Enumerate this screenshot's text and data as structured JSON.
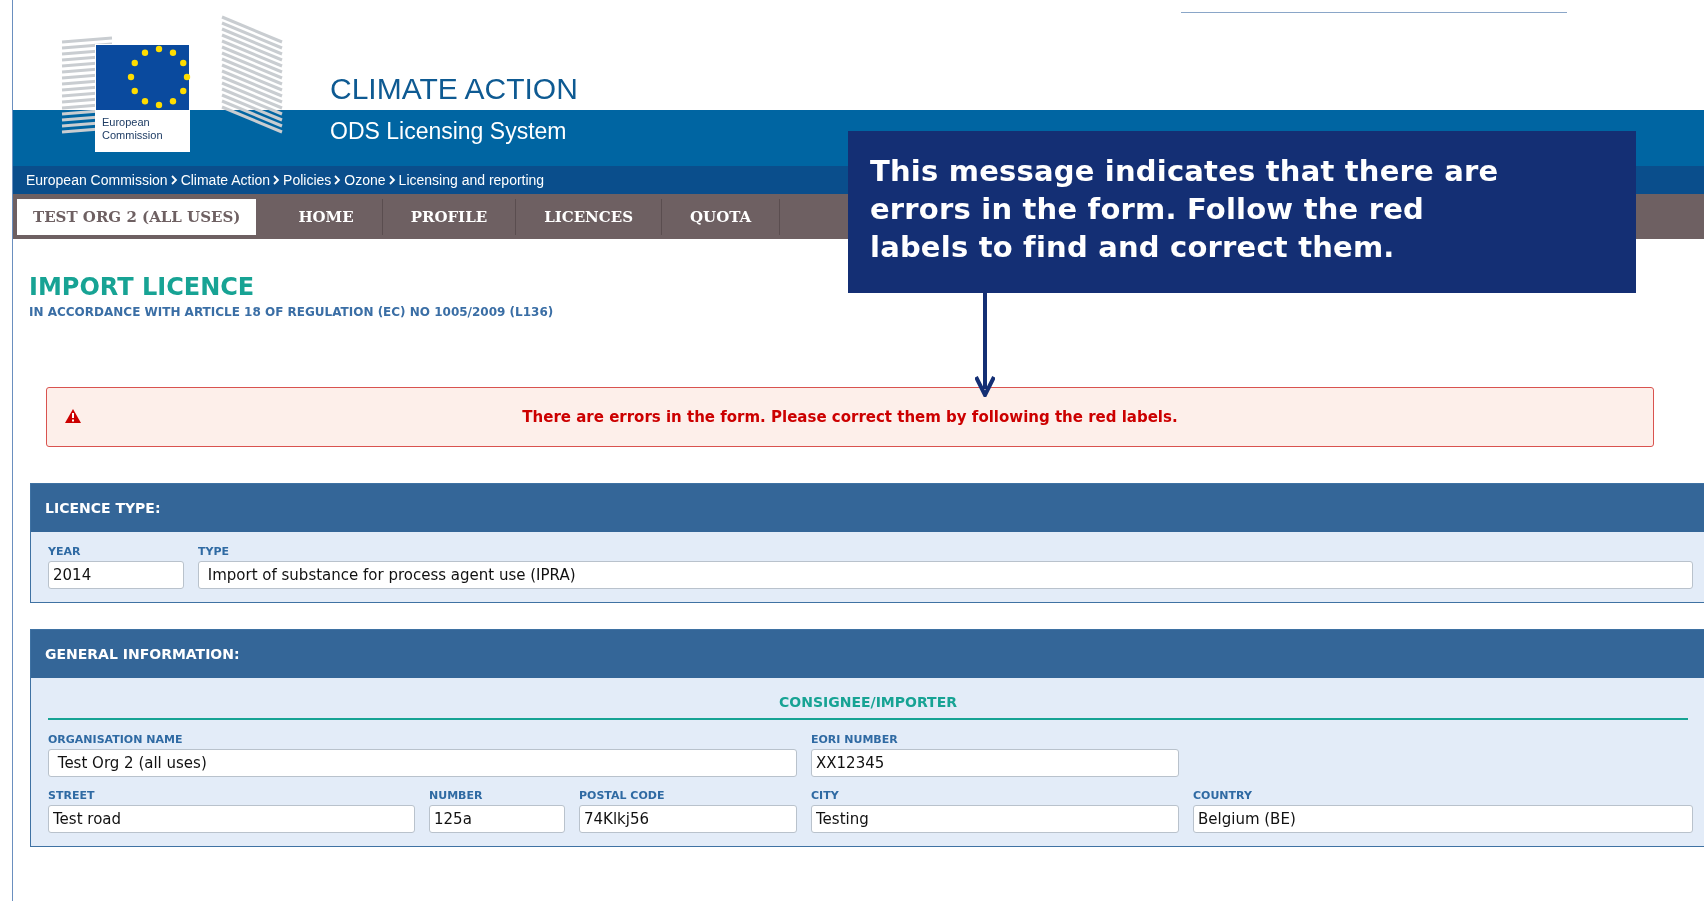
{
  "header": {
    "logo_text": "European Commission",
    "site_title": "CLIMATE ACTION",
    "site_subtitle": "ODS Licensing System"
  },
  "breadcrumb": [
    "European Commission",
    "Climate Action",
    "Policies",
    "Ozone",
    "Licensing and reporting"
  ],
  "nav_tabs": [
    {
      "label": "TEST ORG 2 (ALL USES)",
      "selected": true
    },
    {
      "label": "HOME",
      "selected": false
    },
    {
      "label": "PROFILE",
      "selected": false
    },
    {
      "label": "LICENCES",
      "selected": false
    },
    {
      "label": "QUOTA",
      "selected": false
    }
  ],
  "page": {
    "title": "IMPORT LICENCE",
    "subtitle": "IN ACCORDANCE WITH ARTICLE 18 OF REGULATION (EC) NO 1005/2009 (L136)"
  },
  "error_message": "There are errors in the form. Please correct them by following the red labels.",
  "callout": "This message indicates that there are errors in the form. Follow the red labels to find and correct them.",
  "sections": [
    {
      "title": "LICENCE TYPE:",
      "field_groups": [
        {
          "fields": [
            {
              "label": "YEAR",
              "value": "2014"
            },
            {
              "label": "TYPE",
              "value": " Import of substance for process agent use (IPRA)"
            }
          ]
        }
      ]
    },
    {
      "title": "GENERAL INFORMATION:",
      "subheading": "CONSIGNEE/IMPORTER",
      "field_groups": [
        {
          "fields": [
            {
              "label": "ORGANISATION NAME",
              "value": " Test Org 2 (all uses)"
            },
            {
              "label": "EORI NUMBER",
              "value": "XX12345"
            }
          ]
        },
        {
          "fields": [
            {
              "label": "STREET",
              "value": "Test road"
            },
            {
              "label": "NUMBER",
              "value": "125a"
            },
            {
              "label": "POSTAL CODE",
              "value": "74Klkj56"
            },
            {
              "label": "CITY",
              "value": "Testing"
            },
            {
              "label": "COUNTRY",
              "value": "Belgium (BE)"
            }
          ]
        }
      ]
    }
  ]
}
